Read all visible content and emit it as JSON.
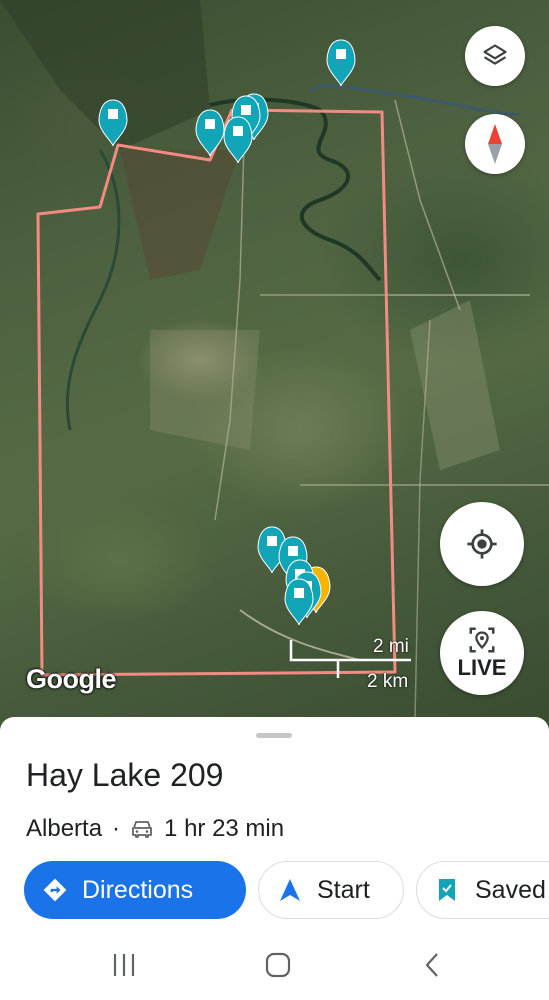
{
  "map": {
    "attribution": "Google",
    "scale_mi": "2 mi",
    "scale_km": "2 km",
    "live_label": "LIVE",
    "controls": [
      "layers-icon",
      "compass-icon",
      "my-location-icon",
      "live-view-icon"
    ]
  },
  "place": {
    "name": "Hay Lake 209",
    "region": "Alberta",
    "separator": "·",
    "drive_time": "1 hr 23 min"
  },
  "actions": {
    "directions": "Directions",
    "start": "Start",
    "saved": "Saved"
  },
  "colors": {
    "accent": "#1a73e8",
    "pin": "#12a5b8",
    "boundary": "#f28b82"
  }
}
